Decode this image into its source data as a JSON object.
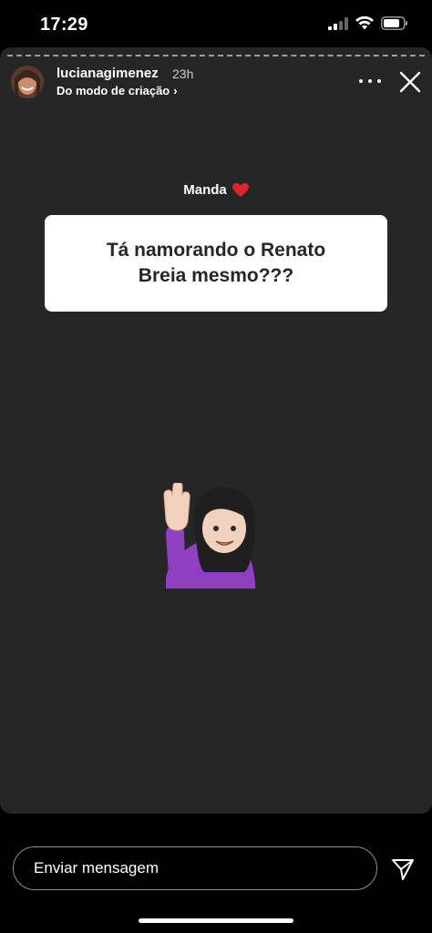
{
  "status_bar": {
    "time": "17:29",
    "signal_icon": "cellular-signal-icon",
    "wifi_icon": "wifi-icon",
    "battery_icon": "battery-icon"
  },
  "story": {
    "username": "lucianagimenez",
    "time_ago": "23h",
    "subtitle": "Do modo de criação",
    "subtitle_chevron": "›",
    "more_icon": "more-horizontal-icon",
    "close_icon": "close-icon"
  },
  "question": {
    "label": "Manda",
    "label_emoji": "❤️",
    "text": "Tá namorando o Renato Breia mesmo???"
  },
  "sticker": {
    "name": "woman-raising-hand-emoji"
  },
  "composer": {
    "placeholder": "Enviar mensagem",
    "send_icon": "send-icon"
  },
  "colors": {
    "background": "#000000",
    "story_bg": "#262626",
    "card_bg": "#ffffff",
    "card_text": "#262626"
  }
}
